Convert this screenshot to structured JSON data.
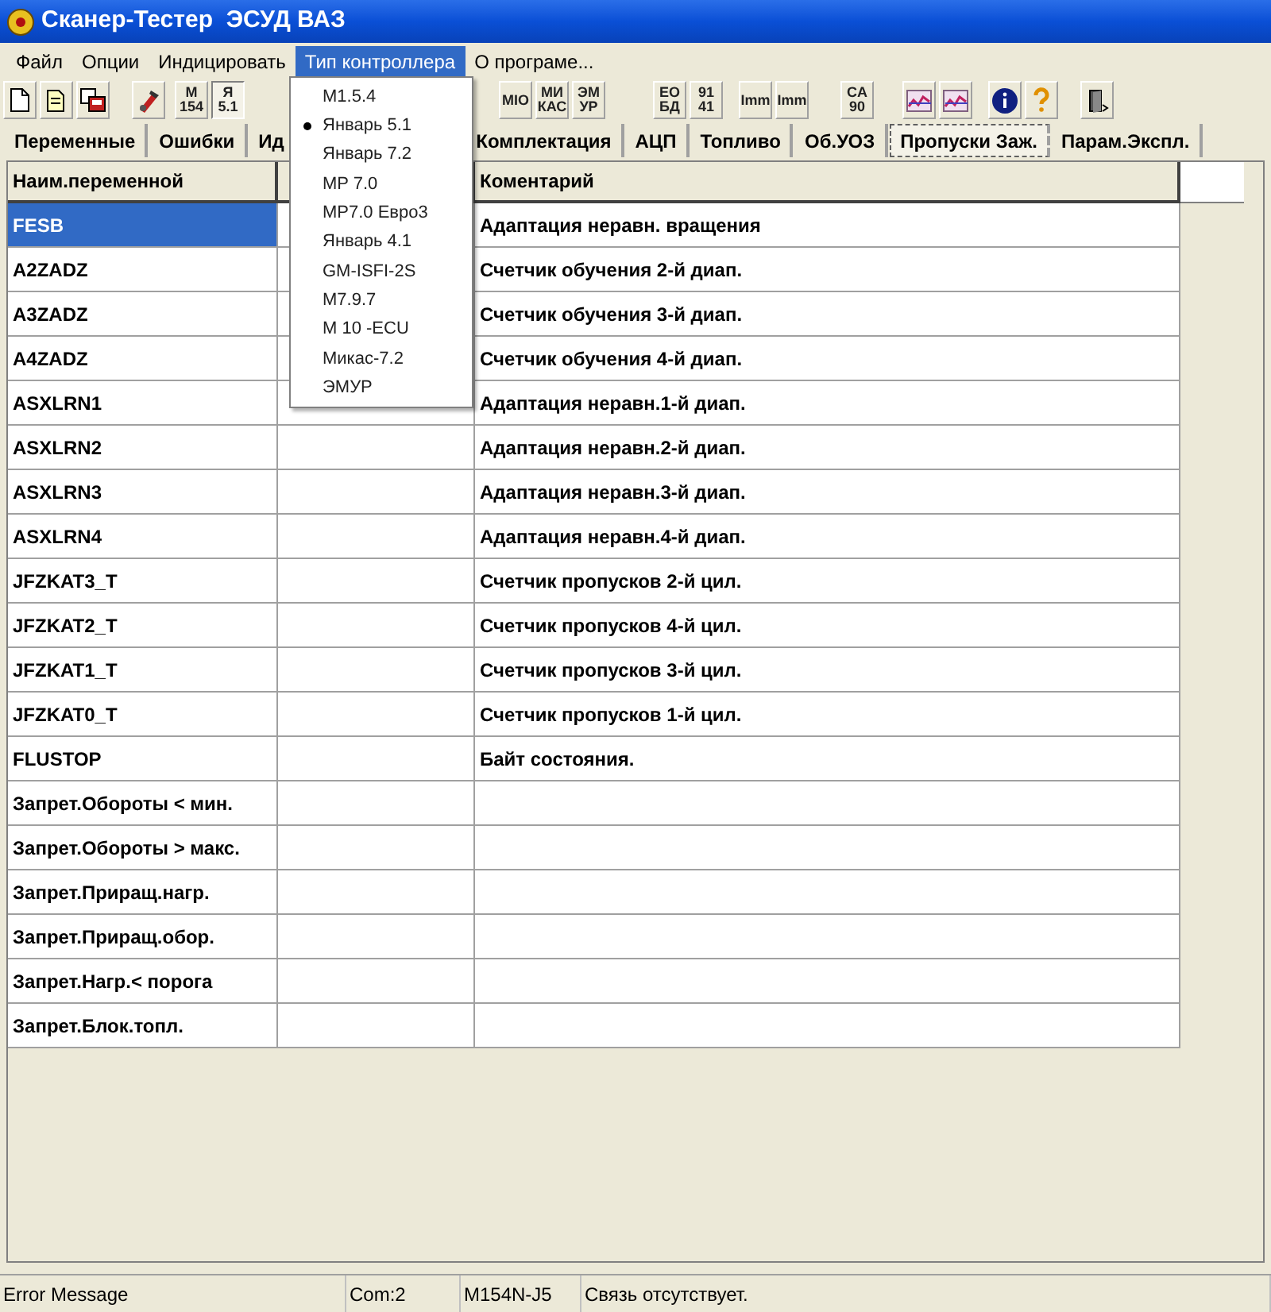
{
  "window": {
    "title": "Сканер-Тестер  ЭСУД ВАЗ"
  },
  "menu": [
    {
      "label": "Файл",
      "selected": false
    },
    {
      "label": "Опции",
      "selected": false
    },
    {
      "label": "Индицировать",
      "selected": false
    },
    {
      "label": "Тип контроллера",
      "selected": true
    },
    {
      "label": "О програме...",
      "selected": false
    }
  ],
  "toolbar": [
    [
      {
        "kind": "new",
        "pressed": false
      },
      {
        "kind": "open",
        "pressed": false
      },
      {
        "kind": "save",
        "pressed": false
      }
    ],
    [
      {
        "kind": "tool",
        "pressed": false
      }
    ],
    [
      {
        "kind": "text",
        "lines": [
          "М",
          "154"
        ],
        "pressed": false
      },
      {
        "kind": "text",
        "lines": [
          "Я",
          "5.1"
        ],
        "pressed": true
      }
    ],
    [
      {
        "kind": "text",
        "lines": [
          "МIO"
        ],
        "pressed": false
      },
      {
        "kind": "text",
        "lines": [
          "МИ",
          "КАС"
        ],
        "pressed": false
      },
      {
        "kind": "text",
        "lines": [
          "ЭМ",
          "УР"
        ],
        "pressed": false
      }
    ],
    [
      {
        "kind": "text",
        "lines": [
          "ЕО",
          "БД"
        ],
        "pressed": false
      },
      {
        "kind": "text",
        "lines": [
          "91",
          "41"
        ],
        "pressed": false
      }
    ],
    [
      {
        "kind": "text",
        "lines": [
          "Imm"
        ],
        "pressed": false
      },
      {
        "kind": "text",
        "lines": [
          "Imm"
        ],
        "pressed": false
      }
    ],
    [
      {
        "kind": "text",
        "lines": [
          "CA",
          "90"
        ],
        "pressed": false
      }
    ],
    [
      {
        "kind": "chart",
        "pressed": false
      },
      {
        "kind": "chart",
        "pressed": false
      }
    ],
    [
      {
        "kind": "info",
        "pressed": false
      },
      {
        "kind": "help",
        "pressed": false
      }
    ],
    [
      {
        "kind": "exit",
        "pressed": false
      }
    ]
  ],
  "tabs": [
    {
      "label": "Переменные",
      "selected": false
    },
    {
      "label": "Ошибки",
      "selected": false
    },
    {
      "label": "Ид",
      "selected": false
    },
    {
      "label": "Комплектация",
      "selected": false
    },
    {
      "label": "АЦП",
      "selected": false
    },
    {
      "label": "Топливо",
      "selected": false
    },
    {
      "label": "Об.УОЗ",
      "selected": false
    },
    {
      "label": "Пропуски Заж.",
      "selected": true
    },
    {
      "label": "Парам.Экспл.",
      "selected": false
    }
  ],
  "table": {
    "columns": [
      "Наим.переменной",
      "Коментарий"
    ],
    "rows": [
      {
        "name": "FESB",
        "comment": "Адаптация неравн. вращения",
        "selected": true
      },
      {
        "name": "A2ZADZ",
        "comment": "Счетчик обучения 2-й диап.",
        "selected": false
      },
      {
        "name": "A3ZADZ",
        "comment": "Счетчик обучения 3-й диап.",
        "selected": false
      },
      {
        "name": "A4ZADZ",
        "comment": "Счетчик обучения 4-й диап.",
        "selected": false
      },
      {
        "name": "ASXLRN1",
        "comment": "Адаптация неравн.1-й диап.",
        "selected": false
      },
      {
        "name": "ASXLRN2",
        "comment": "Адаптация неравн.2-й диап.",
        "selected": false
      },
      {
        "name": "ASXLRN3",
        "comment": "Адаптация неравн.3-й диап.",
        "selected": false
      },
      {
        "name": "ASXLRN4",
        "comment": "Адаптация неравн.4-й диап.",
        "selected": false
      },
      {
        "name": "JFZKAT3_T",
        "comment": "Счетчик пропусков 2-й цил.",
        "selected": false
      },
      {
        "name": "JFZKAT2_T",
        "comment": "Счетчик пропусков 4-й цил.",
        "selected": false
      },
      {
        "name": "JFZKAT1_T",
        "comment": "Счетчик пропусков 3-й цил.",
        "selected": false
      },
      {
        "name": "JFZKAT0_T",
        "comment": "Счетчик пропусков 1-й цил.",
        "selected": false
      },
      {
        "name": "FLUSTOP",
        "comment": "Байт состояния.",
        "selected": false
      },
      {
        "name": "Запрет.Обороты < мин.",
        "selected": false
      },
      {
        "name": "Запрет.Обороты > макс.",
        "selected": false
      },
      {
        "name": "Запрет.Приращ.нагр.",
        "selected": false
      },
      {
        "name": "Запрет.Приращ.обор.",
        "selected": false
      },
      {
        "name": "Запрет.Нагр.< порога",
        "selected": false
      },
      {
        "name": "Запрет.Блок.топл.",
        "selected": false
      }
    ]
  },
  "dropdown": [
    {
      "label": "M1.5.4",
      "selected": false
    },
    {
      "label": "Январь 5.1",
      "selected": true
    },
    {
      "label": "Январь 7.2",
      "selected": false
    },
    {
      "label": "MP 7.0",
      "selected": false
    },
    {
      "label": "MP7.0 Евро3",
      "selected": false
    },
    {
      "label": "Январь 4.1",
      "selected": false
    },
    {
      "label": "GM-ISFI-2S",
      "selected": false
    },
    {
      "label": "M7.9.7",
      "selected": false
    },
    {
      "label": "M 10 -ECU",
      "selected": false
    },
    {
      "label": "Микас-7.2",
      "selected": false
    },
    {
      "label": "ЭМУР",
      "selected": false
    }
  ],
  "status_bar": [
    "Error Message",
    "Com:2",
    "M154N-J5",
    "Связь отсутствует."
  ]
}
